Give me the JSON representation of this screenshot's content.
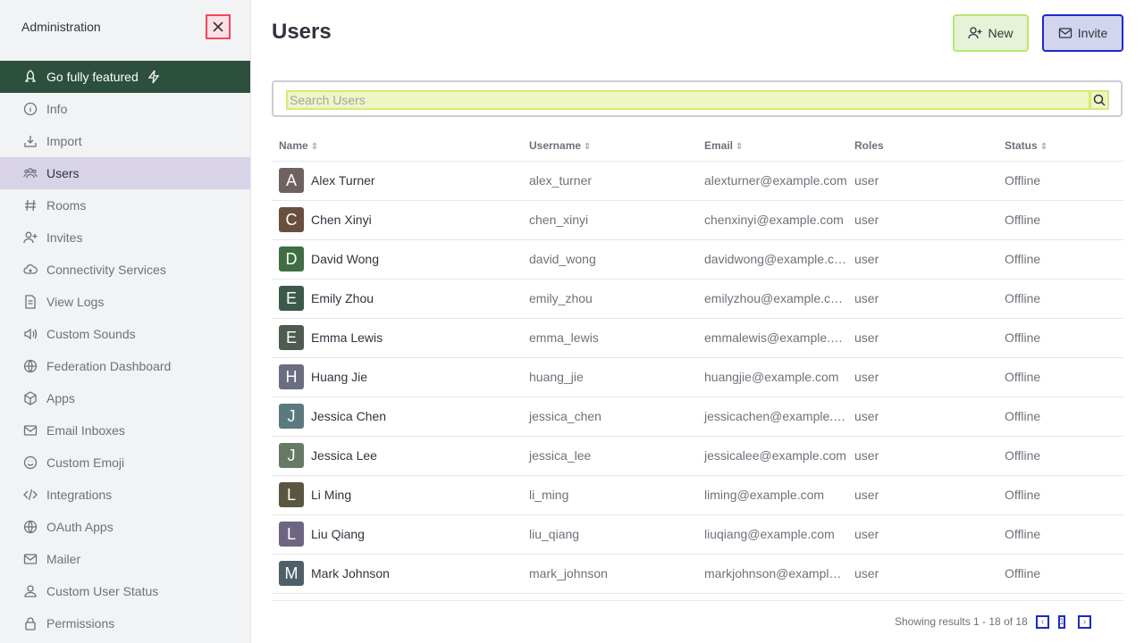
{
  "sidebar": {
    "title": "Administration",
    "items": [
      {
        "label": "Go fully featured",
        "icon": "rocket-icon"
      },
      {
        "label": "Info",
        "icon": "info-icon"
      },
      {
        "label": "Import",
        "icon": "import-icon"
      },
      {
        "label": "Users",
        "icon": "users-icon"
      },
      {
        "label": "Rooms",
        "icon": "hashtag-icon"
      },
      {
        "label": "Invites",
        "icon": "user-plus-icon"
      },
      {
        "label": "Connectivity Services",
        "icon": "cloud-icon"
      },
      {
        "label": "View Logs",
        "icon": "document-icon"
      },
      {
        "label": "Custom Sounds",
        "icon": "sound-icon"
      },
      {
        "label": "Federation Dashboard",
        "icon": "globe-icon"
      },
      {
        "label": "Apps",
        "icon": "cube-icon"
      },
      {
        "label": "Email Inboxes",
        "icon": "mail-icon"
      },
      {
        "label": "Custom Emoji",
        "icon": "emoji-icon"
      },
      {
        "label": "Integrations",
        "icon": "code-icon"
      },
      {
        "label": "OAuth Apps",
        "icon": "globe-icon"
      },
      {
        "label": "Mailer",
        "icon": "mail-icon"
      },
      {
        "label": "Custom User Status",
        "icon": "user-icon"
      },
      {
        "label": "Permissions",
        "icon": "lock-icon"
      }
    ]
  },
  "header": {
    "title": "Users",
    "new_label": "New",
    "invite_label": "Invite"
  },
  "search": {
    "placeholder": "Search Users"
  },
  "table": {
    "columns": [
      "Name",
      "Username",
      "Email",
      "Roles",
      "Status"
    ],
    "rows": [
      {
        "initial": "A",
        "name": "Alex Turner",
        "username": "alex_turner",
        "email": "alexturner@example.com",
        "role": "user",
        "status": "Offline",
        "color": "#6e6260"
      },
      {
        "initial": "C",
        "name": "Chen Xinyi",
        "username": "chen_xinyi",
        "email": "chenxinyi@example.com",
        "role": "user",
        "status": "Offline",
        "color": "#6a4f3f"
      },
      {
        "initial": "D",
        "name": "David Wong",
        "username": "david_wong",
        "email": "davidwong@example.com",
        "role": "user",
        "status": "Offline",
        "color": "#3f6e44"
      },
      {
        "initial": "E",
        "name": "Emily Zhou",
        "username": "emily_zhou",
        "email": "emilyzhou@example.com",
        "role": "user",
        "status": "Offline",
        "color": "#3c5a4b"
      },
      {
        "initial": "E",
        "name": "Emma Lewis",
        "username": "emma_lewis",
        "email": "emmalewis@example.com",
        "role": "user",
        "status": "Offline",
        "color": "#4d5b50"
      },
      {
        "initial": "H",
        "name": "Huang Jie",
        "username": "huang_jie",
        "email": "huangjie@example.com",
        "role": "user",
        "status": "Offline",
        "color": "#6a6e80"
      },
      {
        "initial": "J",
        "name": "Jessica Chen",
        "username": "jessica_chen",
        "email": "jessicachen@example.com",
        "role": "user",
        "status": "Offline",
        "color": "#5a7a80"
      },
      {
        "initial": "J",
        "name": "Jessica Lee",
        "username": "jessica_lee",
        "email": "jessicalee@example.com",
        "role": "user",
        "status": "Offline",
        "color": "#667a66"
      },
      {
        "initial": "L",
        "name": "Li Ming",
        "username": "li_ming",
        "email": "liming@example.com",
        "role": "user",
        "status": "Offline",
        "color": "#5a5640"
      },
      {
        "initial": "L",
        "name": "Liu Qiang",
        "username": "liu_qiang",
        "email": "liuqiang@example.com",
        "role": "user",
        "status": "Offline",
        "color": "#6e6680"
      },
      {
        "initial": "M",
        "name": "Mark Johnson",
        "username": "mark_johnson",
        "email": "markjohnson@example.com",
        "role": "user",
        "status": "Offline",
        "color": "#50606a"
      }
    ]
  },
  "footer": {
    "results": "Showing results 1 - 18 of 18",
    "prev": "‹",
    "page": "1",
    "next": "›"
  }
}
